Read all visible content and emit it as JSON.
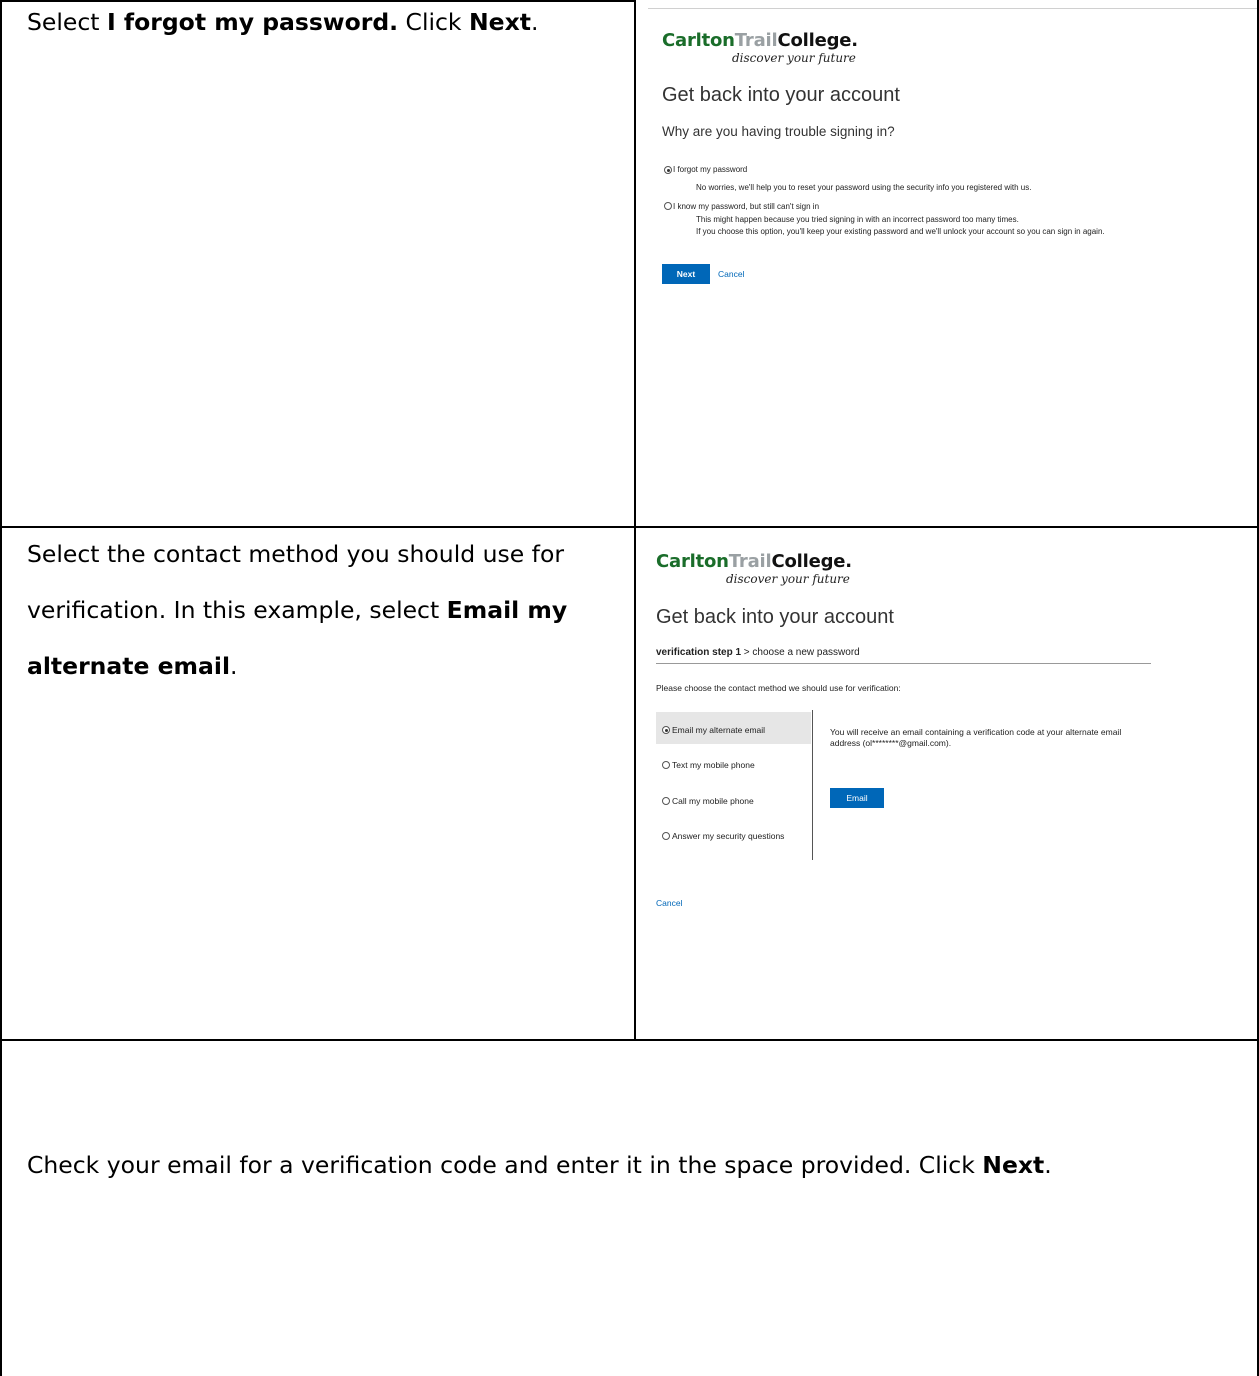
{
  "rows": [
    {
      "instruction_parts": [
        "Select ",
        "I forgot my password.",
        " Click ",
        "Next",
        "."
      ],
      "screenshot": {
        "logo": {
          "carlton": "Carlton",
          "trail": "Trail",
          "college": "College.",
          "tagline": "discover your future"
        },
        "heading": "Get back into your account",
        "subheading": "Why are you having trouble signing in?",
        "options": [
          {
            "label": "I forgot my password",
            "selected": true,
            "desc": [
              "No worries, we'll help you to reset your password using the security info you registered with us."
            ]
          },
          {
            "label": "I know my password, but still can't sign in",
            "selected": false,
            "desc": [
              "This might happen because you tried signing in with an incorrect password too many times.",
              "If you choose this option, you'll keep your existing password and we'll unlock your account so you can sign in again."
            ]
          }
        ],
        "next_label": "Next",
        "cancel_label": "Cancel"
      }
    },
    {
      "instruction_lines": [
        [
          "Select the contact method you should use for"
        ],
        [
          "verification.  In this example, select ",
          "Email my"
        ],
        [
          "alternate email",
          "."
        ]
      ],
      "screenshot": {
        "logo": {
          "carlton": "Carlton",
          "trail": "Trail",
          "college": "College.",
          "tagline": "discover your future"
        },
        "heading": "Get back into your account",
        "step_bold": "verification step 1",
        "step_rest": " > choose a new password",
        "prompt": "Please choose the contact method we should use for verification:",
        "methods": [
          {
            "label": "Email my alternate email",
            "selected": true
          },
          {
            "label": "Text my mobile phone",
            "selected": false
          },
          {
            "label": "Call my mobile phone",
            "selected": false
          },
          {
            "label": "Answer my security questions",
            "selected": false
          }
        ],
        "detail_lines": [
          "You will receive an email containing a verification code at your alternate email",
          "address (ol********@gmail.com)."
        ],
        "email_button": "Email",
        "cancel_label": "Cancel"
      }
    },
    {
      "instruction_parts": [
        "Check your email for a verification code and enter it in the space provided.  Click ",
        "Next",
        "."
      ]
    }
  ]
}
